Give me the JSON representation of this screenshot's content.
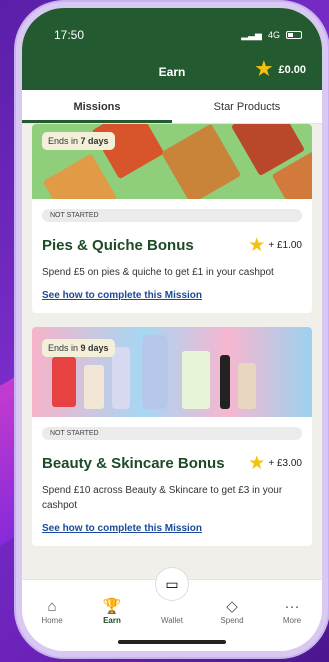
{
  "status": {
    "time": "17:50",
    "network": "4G"
  },
  "header": {
    "title": "Earn",
    "balance": "£0.00"
  },
  "tabs": [
    {
      "label": "Missions"
    },
    {
      "label": "Star Products"
    }
  ],
  "missions": [
    {
      "badge_prefix": "Ends in",
      "badge_bold": "7 days",
      "status": "NOT STARTED",
      "name": "Pies & Quiche Bonus",
      "reward": "+ £1.00",
      "description": "Spend £5 on pies & quiche to get £1 in your cashpot",
      "link": "See how to complete this Mission"
    },
    {
      "badge_prefix": "Ends in",
      "badge_bold": "9 days",
      "status": "NOT STARTED",
      "name": "Beauty & Skincare Bonus",
      "reward": "+ £3.00",
      "description": "Spend £10 across Beauty & Skincare to get £3 in your cashpot",
      "link": "See how to complete this Mission"
    }
  ],
  "nav": [
    {
      "label": "Home",
      "icon": "home-icon"
    },
    {
      "label": "Earn",
      "icon": "trophy-icon"
    },
    {
      "label": "Wallet",
      "icon": "wallet-icon"
    },
    {
      "label": "Spend",
      "icon": "tag-icon"
    },
    {
      "label": "More",
      "icon": "more-icon"
    }
  ]
}
